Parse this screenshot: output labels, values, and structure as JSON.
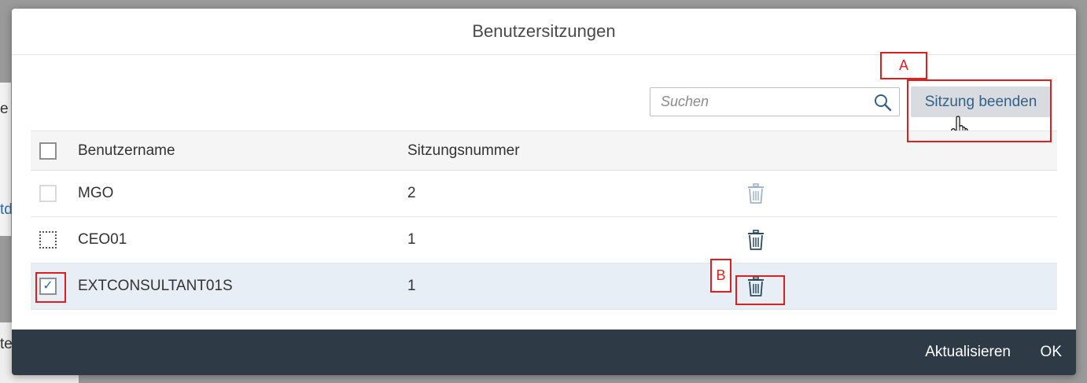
{
  "background": {
    "fragment_1": "e",
    "fragment_2": "td",
    "fragment_3": "te"
  },
  "dialog": {
    "title": "Benutzersitzungen",
    "search": {
      "placeholder": "Suchen",
      "value": ""
    },
    "end_session_button": "Sitzung beenden",
    "table": {
      "headers": {
        "username": "Benutzername",
        "session_number": "Sitzungsnummer"
      },
      "rows": [
        {
          "username": "MGO",
          "session": "2",
          "checked": false,
          "checkbox_state": "disabled"
        },
        {
          "username": "CEO01",
          "session": "1",
          "checked": false,
          "checkbox_state": "focused"
        },
        {
          "username": "EXTCONSULTANT01S",
          "session": "1",
          "checked": true,
          "checkbox_state": "checked"
        }
      ]
    },
    "footer": {
      "refresh": "Aktualisieren",
      "ok": "OK"
    }
  },
  "annotations": {
    "a": "A",
    "b": "B"
  },
  "colors": {
    "accent": "#2b6aa6",
    "footer_bg": "#2e3a45",
    "button_bg": "#d8dbdf",
    "selected_row": "#e8eef6",
    "annotation": "#e01e1e"
  }
}
